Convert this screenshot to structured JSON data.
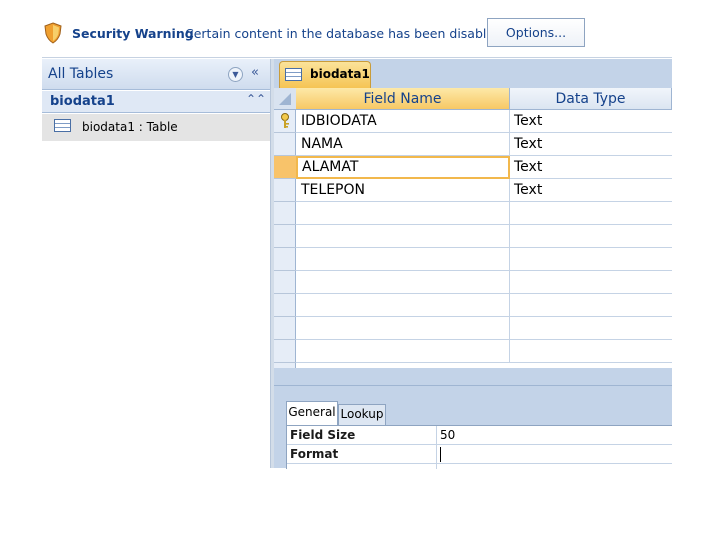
{
  "security_bar": {
    "title": "Security Warning",
    "message": "Certain content in the database has been disabled",
    "options_label": "Options...",
    "icon": "shield-icon"
  },
  "navigation_pane": {
    "header_label": "All Tables",
    "group_label": "biodata1",
    "items": [
      {
        "label": "biodata1 : Table",
        "icon": "table-icon"
      }
    ]
  },
  "document_tab": {
    "label": "biodata1",
    "icon": "table-icon"
  },
  "design_grid": {
    "columns": [
      "Field Name",
      "Data Type"
    ],
    "rows": [
      {
        "field": "IDBIODATA",
        "type": "Text",
        "primary_key": true
      },
      {
        "field": "NAMA",
        "type": "Text"
      },
      {
        "field": "ALAMAT",
        "type": "Text",
        "current": true
      },
      {
        "field": "TELEPON",
        "type": "Text"
      }
    ]
  },
  "field_properties": {
    "tabs": [
      "General",
      "Lookup"
    ],
    "active_tab": "General",
    "rows": [
      {
        "name": "Field Size",
        "value": "50"
      },
      {
        "name": "Format",
        "value": ""
      }
    ]
  },
  "colors": {
    "accent_blue": "#15428b",
    "selected_header": "#f7c865",
    "current_row_marker": "#f8c36a",
    "pane_background": "#c3d3e8"
  }
}
